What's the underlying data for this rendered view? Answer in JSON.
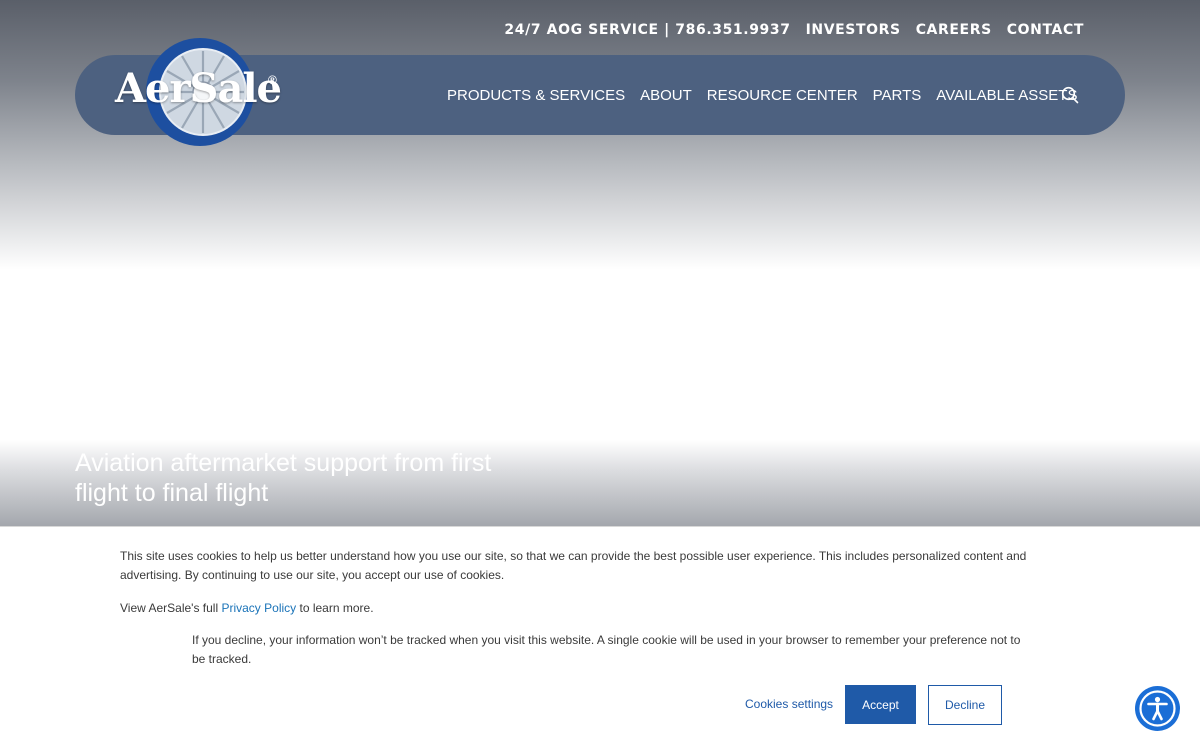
{
  "colors": {
    "nav_pill": "#4d6180",
    "accent_blue": "#1f5aa8",
    "accessibility_button": "#1b6ed6",
    "link": "#1a73b8"
  },
  "top_bar": {
    "aog_service": "24/7 AOG SERVICE | 786.351.9937",
    "investors": "INVESTORS",
    "careers": "CAREERS",
    "contact": "CONTACT"
  },
  "logo": {
    "text": "AerSale",
    "registered": "®"
  },
  "main_nav": {
    "items": [
      {
        "label": "PRODUCTS & SERVICES"
      },
      {
        "label": "ABOUT"
      },
      {
        "label": "RESOURCE CENTER"
      },
      {
        "label": "PARTS"
      },
      {
        "label": "AVAILABLE ASSETS"
      }
    ],
    "search_icon": "search-icon"
  },
  "hero": {
    "tagline": "Aviation aftermarket support from first flight to final flight"
  },
  "cookie_banner": {
    "text1": "This site uses cookies to help us better understand how you use our site, so that we can provide the best possible user experience.  This includes personalized content and advertising. By continuing to use our site, you accept our use of cookies.",
    "text2_prefix": "View AerSale's full ",
    "privacy_link": "Privacy Policy",
    "text2_suffix": " to learn more.",
    "text3": "If you decline, your information won’t be tracked when you visit this website. A single cookie will be used in your browser to remember your preference not to be tracked.",
    "settings_label": "Cookies settings",
    "accept_label": "Accept",
    "decline_label": "Decline"
  },
  "accessibility": {
    "icon": "accessibility-icon"
  }
}
